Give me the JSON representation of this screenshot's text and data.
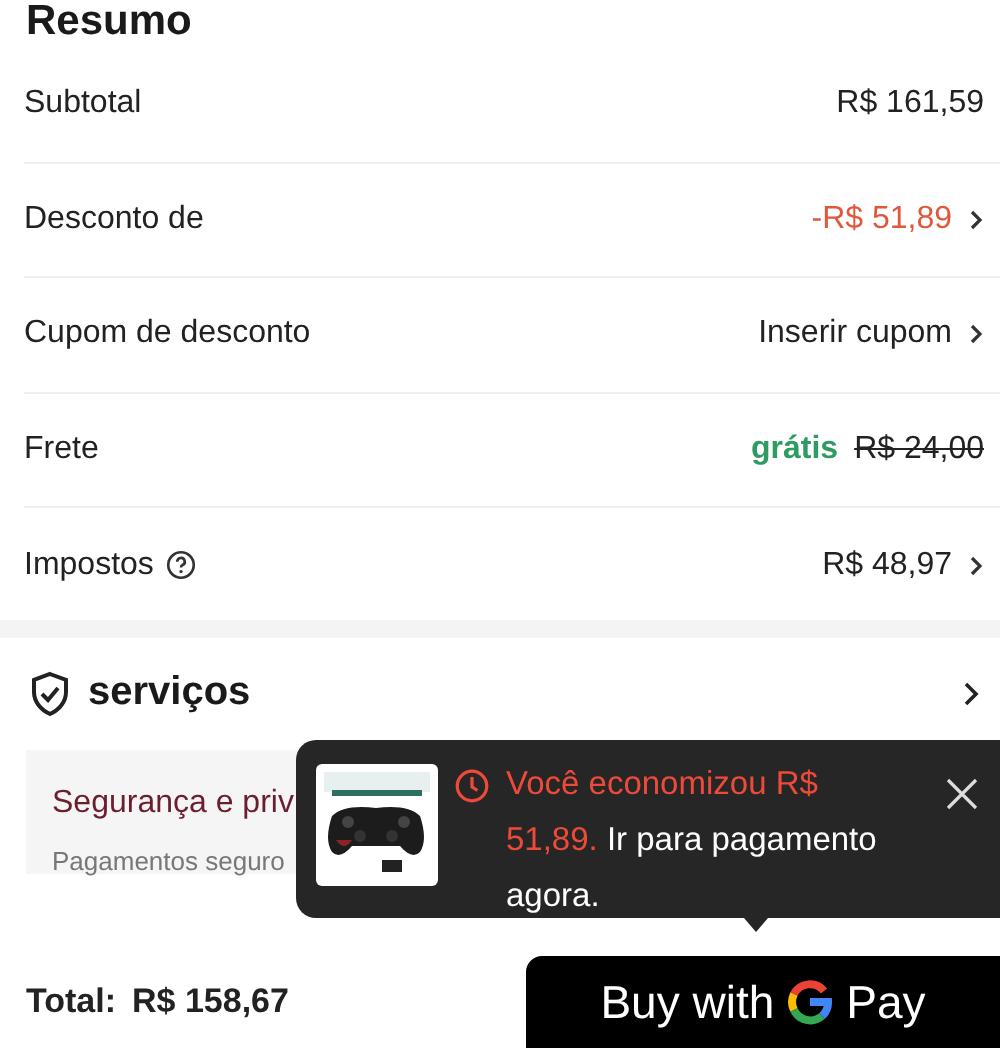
{
  "summary": {
    "title": "Resumo",
    "rows": [
      {
        "kind": "plain",
        "label": "Subtotal",
        "value": "R$ 161,59",
        "chevron": false
      },
      {
        "kind": "discount",
        "label": "Desconto de",
        "value": "-R$ 51,89",
        "chevron": true
      },
      {
        "kind": "plain",
        "label": "Cupom de desconto",
        "value": "Inserir cupom",
        "chevron": true
      },
      {
        "kind": "shipping",
        "label": "Frete",
        "value": "grátis",
        "old_value": "R$ 24,00",
        "chevron": false
      },
      {
        "kind": "plain",
        "label": "Impostos",
        "info": true,
        "value": "R$ 48,97",
        "chevron": true
      }
    ]
  },
  "services": {
    "title": "serviços",
    "cards": [
      {
        "title": "Segurança e priv",
        "text": "Pagamentos seguro"
      }
    ]
  },
  "popup": {
    "highlight": "Você economizou R$ 51,89.",
    "message": "Ir para pagamento agora."
  },
  "footer": {
    "total_label": "Total:",
    "total_value": "R$ 158,67",
    "pay_button": {
      "text_before": "Buy with",
      "text_after": "Pay"
    }
  }
}
